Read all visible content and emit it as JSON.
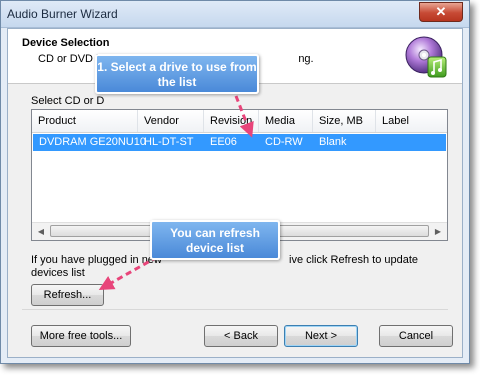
{
  "window": {
    "title": "Audio Burner Wizard",
    "close_glyph": "✕"
  },
  "header": {
    "title": "Device Selection",
    "description_left": "CD or DVD b",
    "description_right": "ng."
  },
  "device_group": {
    "label_left": "Select CD or D",
    "label_right": ""
  },
  "device_table": {
    "columns": [
      "Product",
      "Vendor",
      "Revision",
      "Media",
      "Size, MB",
      "Label"
    ],
    "rows": [
      {
        "product": "DVDRAM GE20NU10",
        "vendor": "HL-DT-ST",
        "revision": "EE06",
        "media": "CD-RW",
        "size": "Blank",
        "label": ""
      }
    ]
  },
  "hint": {
    "line1_left": "If you have plugged in new",
    "line1_right": "ive click Refresh to update",
    "line2": "devices list"
  },
  "buttons": {
    "refresh": "Refresh...",
    "more_tools": "More free tools...",
    "back": "< Back",
    "next": "Next >",
    "cancel": "Cancel"
  },
  "callouts": {
    "select_drive": "1. Select a drive to use from the list",
    "refresh_hint": "You can refresh device list"
  },
  "icons": {
    "app_icon": "cd-music-icon"
  },
  "colors": {
    "selection": "#3399ff",
    "callout": "#5b9be2",
    "arrow": "#e8457a"
  }
}
